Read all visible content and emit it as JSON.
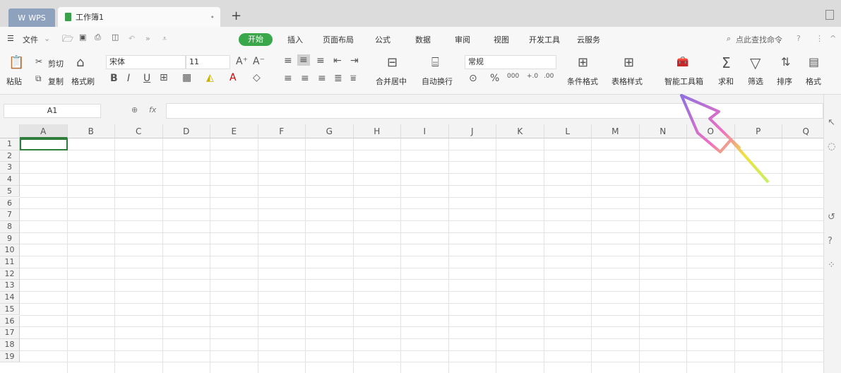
{
  "tabs": {
    "wps": "WPS",
    "doc": "工作簿1",
    "new": "+"
  },
  "menu": {
    "file": "文件",
    "items": [
      "开始",
      "插入",
      "页面布局",
      "公式",
      "数据",
      "审阅",
      "视图",
      "开发工具",
      "云服务"
    ],
    "search": "点此查找命令",
    "help": "?"
  },
  "ribbon": {
    "paste": "粘贴",
    "cut": "剪切",
    "copy": "复制",
    "format_painter": "格式刷",
    "font": "宋体",
    "size": "11",
    "merge": "合并居中",
    "wrap": "自动换行",
    "number_format": "常规",
    "cond_format": "条件格式",
    "table_style": "表格样式",
    "smart_toolbox": "智能工具箱",
    "sum": "求和",
    "filter": "筛选",
    "sort": "排序",
    "format": "格式"
  },
  "formula": {
    "cell": "A1",
    "fx": "fx",
    "value": ""
  },
  "columns": [
    "A",
    "B",
    "C",
    "D",
    "E",
    "F",
    "G",
    "H",
    "I",
    "J",
    "K",
    "L",
    "M",
    "N",
    "O",
    "P",
    "Q"
  ],
  "rows": [
    "1",
    "2",
    "3",
    "4",
    "5",
    "6",
    "7",
    "8",
    "9",
    "10",
    "11",
    "12",
    "13",
    "14",
    "15",
    "16",
    "17",
    "18",
    "19"
  ],
  "colors": {
    "accent": "#3aa74a"
  }
}
